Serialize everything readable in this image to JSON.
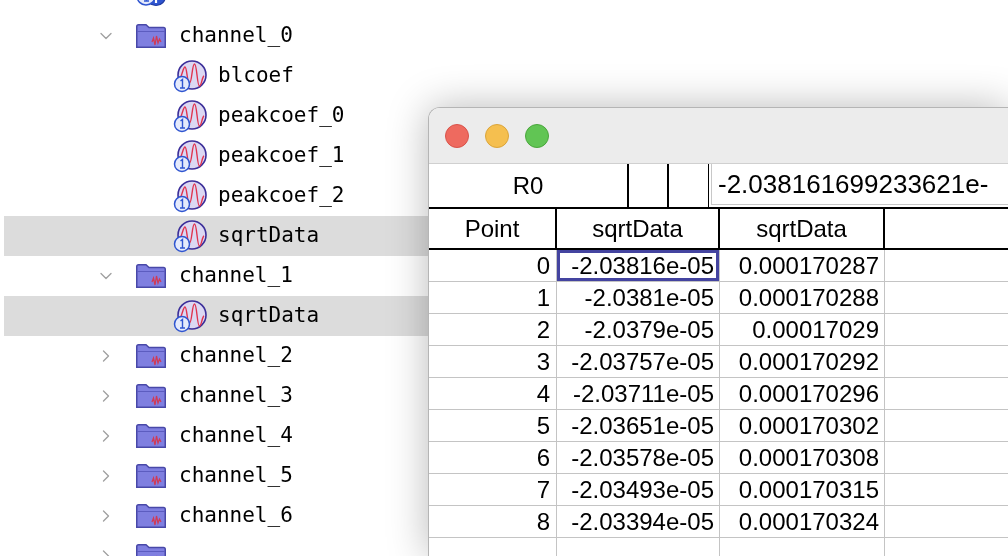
{
  "tree": {
    "items": [
      {
        "kind": "info",
        "selected": false
      },
      {
        "label": "channel_0",
        "kind": "folder",
        "expanded": true,
        "selected": false,
        "children": [
          {
            "label": "blcoef",
            "kind": "wave",
            "selected": false
          },
          {
            "label": "peakcoef_0",
            "kind": "wave",
            "selected": false
          },
          {
            "label": "peakcoef_1",
            "kind": "wave",
            "selected": false
          },
          {
            "label": "peakcoef_2",
            "kind": "wave",
            "selected": false
          },
          {
            "label": "sqrtData",
            "kind": "wave",
            "selected": true
          }
        ]
      },
      {
        "label": "channel_1",
        "kind": "folder",
        "expanded": true,
        "selected": false,
        "children": [
          {
            "label": "sqrtData",
            "kind": "wave",
            "selected": true
          }
        ]
      },
      {
        "label": "channel_2",
        "kind": "folder",
        "expanded": false,
        "selected": false
      },
      {
        "label": "channel_3",
        "kind": "folder",
        "expanded": false,
        "selected": false
      },
      {
        "label": "channel_4",
        "kind": "folder",
        "expanded": false,
        "selected": false
      },
      {
        "label": "channel_5",
        "kind": "folder",
        "expanded": false,
        "selected": false
      },
      {
        "label": "channel_6",
        "kind": "folder",
        "expanded": false,
        "selected": false
      },
      {
        "kind": "folder",
        "expanded": false,
        "selected": false
      }
    ]
  },
  "table_window": {
    "formula_bar": {
      "cell_name": "R0",
      "value": "-2.038161699233621e-"
    },
    "table": {
      "columns": [
        "Point",
        "sqrtData",
        "sqrtData"
      ],
      "rows": [
        {
          "cells": [
            {
              "text": "0",
              "selected": false
            },
            {
              "text": "-2.03816e-05",
              "selected": true
            },
            {
              "text": "0.000170287",
              "selected": false
            }
          ]
        },
        {
          "cells": [
            {
              "text": "1",
              "selected": false
            },
            {
              "text": "-2.0381e-05",
              "selected": false
            },
            {
              "text": "0.000170288",
              "selected": false
            }
          ]
        },
        {
          "cells": [
            {
              "text": "2",
              "selected": false
            },
            {
              "text": "-2.0379e-05",
              "selected": false
            },
            {
              "text": "0.00017029",
              "selected": false
            }
          ]
        },
        {
          "cells": [
            {
              "text": "3",
              "selected": false
            },
            {
              "text": "-2.03757e-05",
              "selected": false
            },
            {
              "text": "0.000170292",
              "selected": false
            }
          ]
        },
        {
          "cells": [
            {
              "text": "4",
              "selected": false
            },
            {
              "text": "-2.03711e-05",
              "selected": false
            },
            {
              "text": "0.000170296",
              "selected": false
            }
          ]
        },
        {
          "cells": [
            {
              "text": "5",
              "selected": false
            },
            {
              "text": "-2.03651e-05",
              "selected": false
            },
            {
              "text": "0.000170302",
              "selected": false
            }
          ]
        },
        {
          "cells": [
            {
              "text": "6",
              "selected": false
            },
            {
              "text": "-2.03578e-05",
              "selected": false
            },
            {
              "text": "0.000170308",
              "selected": false
            }
          ]
        },
        {
          "cells": [
            {
              "text": "7",
              "selected": false
            },
            {
              "text": "-2.03493e-05",
              "selected": false
            },
            {
              "text": "0.000170315",
              "selected": false
            }
          ]
        },
        {
          "cells": [
            {
              "text": "8",
              "selected": false
            },
            {
              "text": "-2.03394e-05",
              "selected": false
            },
            {
              "text": "0.000170324",
              "selected": false
            }
          ]
        }
      ]
    }
  }
}
